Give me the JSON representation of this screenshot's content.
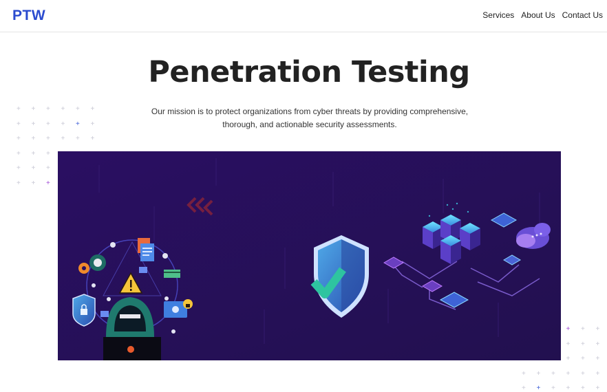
{
  "nav": {
    "logo": "PTW",
    "links": [
      {
        "label": "Services"
      },
      {
        "label": "About Us"
      },
      {
        "label": "Contact Us"
      }
    ]
  },
  "hero": {
    "title": "Penetration Testing",
    "description": "Our mission is to protect organizations from cyber threats by providing comprehensive, thorough, and actionable security assessments."
  },
  "banner": {
    "icons": [
      "hacker-icon",
      "shield-icon",
      "server-icon",
      "cloud-icon",
      "warning-icon",
      "lock-icon",
      "gear-icon",
      "document-icon"
    ]
  },
  "colors": {
    "brand": "#2b4bcf",
    "banner_bg": "#281160",
    "accent_cyan": "#3fd0e6",
    "accent_purple": "#a04bd6"
  }
}
